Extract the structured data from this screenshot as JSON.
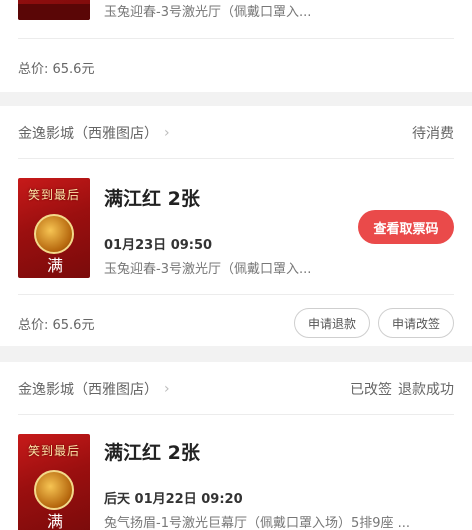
{
  "order0": {
    "hall": "玉兔迎春-3号激光厅（佩戴口罩入...",
    "price": "总价:  65.6元"
  },
  "order1": {
    "cinema": "金逸影城（西雅图店）",
    "status": "待消费",
    "movie_title": "满江红  2张",
    "time": "01月23日 09:50",
    "hall": "玉兔迎春-3号激光厅（佩戴口罩入...",
    "action_button": "查看取票码",
    "price": "总价:  65.6元",
    "btn_refund": "申请退款",
    "btn_change": "申请改签",
    "poster_text": "笑到最后",
    "poster_char": "满"
  },
  "order2": {
    "cinema": "金逸影城（西雅图店）",
    "status_a": "已改签",
    "status_b": "退款成功",
    "movie_title": "满江红  2张",
    "time": "后天 01月22日 09:20",
    "hall": "兔气扬眉-1号激光巨幕厅（佩戴口罩入场）5排9座 ...",
    "poster_text": "笑到最后",
    "poster_char": "满"
  },
  "icons": {
    "chevron": "chevron-right-icon"
  }
}
